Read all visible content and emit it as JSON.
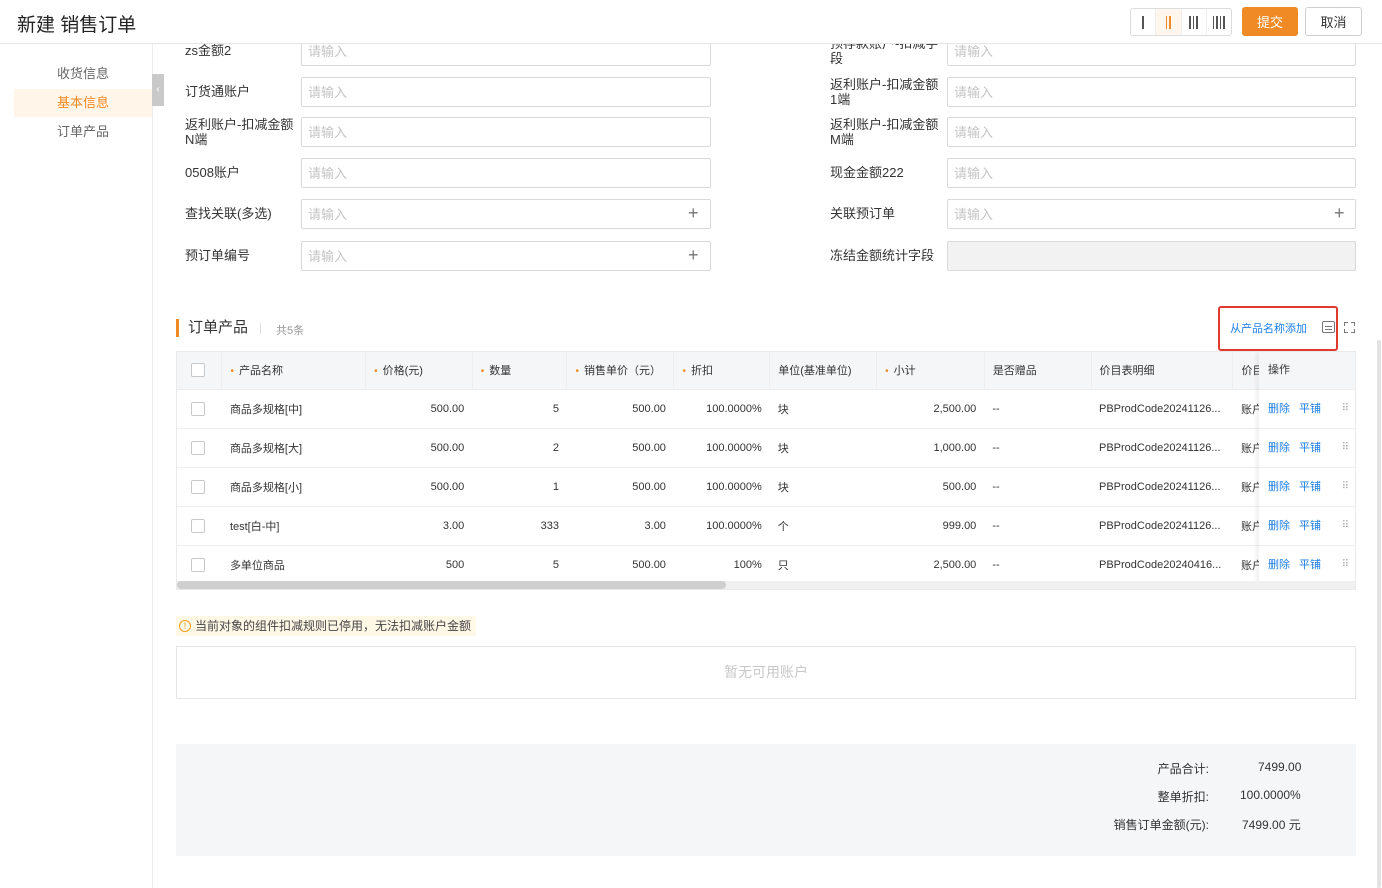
{
  "header": {
    "title": "新建 销售订单",
    "submit_label": "提交",
    "cancel_label": "取消",
    "layout_options": [
      "one-column",
      "two-column",
      "three-column",
      "four-column"
    ],
    "active_layout": "two-column",
    "accent_color": "#f08a24"
  },
  "sidebar": {
    "items": [
      {
        "label": "收货信息",
        "active": false
      },
      {
        "label": "基本信息",
        "active": true
      },
      {
        "label": "订单产品",
        "active": false
      }
    ],
    "collapse_glyph": "‹"
  },
  "form": {
    "placeholder": "请输入",
    "left": [
      {
        "label": "zs金额2"
      },
      {
        "label": "订货通账户"
      },
      {
        "label": "返利账户-扣减金额N端"
      },
      {
        "label": "0508账户"
      },
      {
        "label": "查找关联(多选)",
        "lookup": true
      },
      {
        "label": "预订单编号",
        "lookup": true
      }
    ],
    "right": [
      {
        "label": "预存款账户-扣减字段"
      },
      {
        "label": "返利账户-扣减金额1端"
      },
      {
        "label": "返利账户-扣减金额M端"
      },
      {
        "label": "现金金额222"
      },
      {
        "label": "关联预订单",
        "lookup": true
      },
      {
        "label": "冻结金额统计字段",
        "disabled": true
      }
    ]
  },
  "products": {
    "title": "订单产品",
    "count_label": "共5条",
    "add_link": "从产品名称添加",
    "columns": {
      "name": "产品名称",
      "price": "价格(元)",
      "qty": "数量",
      "unit_price": "销售单价（元）",
      "discount": "折扣",
      "unit": "单位(基准单位)",
      "subtotal": "小计",
      "gift": "是否赠品",
      "pricebook": "价目表明细",
      "pricebook_short": "价目",
      "ops": "操作"
    },
    "rows": [
      {
        "name": "商品多规格[中]",
        "price": "500.00",
        "qty": "5",
        "unit_price": "500.00",
        "discount": "100.0000%",
        "unit": "块",
        "subtotal": "2,500.00",
        "gift": "--",
        "pricebook": "PBProdCode20241126...",
        "pb_short": "账户"
      },
      {
        "name": "商品多规格[大]",
        "price": "500.00",
        "qty": "2",
        "unit_price": "500.00",
        "discount": "100.0000%",
        "unit": "块",
        "subtotal": "1,000.00",
        "gift": "--",
        "pricebook": "PBProdCode20241126...",
        "pb_short": "账户"
      },
      {
        "name": "商品多规格[小]",
        "price": "500.00",
        "qty": "1",
        "unit_price": "500.00",
        "discount": "100.0000%",
        "unit": "块",
        "subtotal": "500.00",
        "gift": "--",
        "pricebook": "PBProdCode20241126...",
        "pb_short": "账户"
      },
      {
        "name": "test[白-中]",
        "price": "3.00",
        "qty": "333",
        "unit_price": "3.00",
        "discount": "100.0000%",
        "unit": "个",
        "subtotal": "999.00",
        "gift": "--",
        "pricebook": "PBProdCode20241126...",
        "pb_short": "账户"
      },
      {
        "name": "多单位商品",
        "price": "500",
        "qty": "5",
        "unit_price": "500.00",
        "discount": "100%",
        "unit": "只",
        "subtotal": "2,500.00",
        "gift": "--",
        "pricebook": "PBProdCode20240416...",
        "pb_short": "账户"
      }
    ],
    "op_delete": "删除",
    "op_tile": "平铺",
    "drag_glyph": "⠿"
  },
  "notice": {
    "text": "当前对象的组件扣减规则已停用，无法扣减账户金额",
    "icon_glyph": "!"
  },
  "accounts": {
    "empty_text": "暂无可用账户"
  },
  "summary": {
    "items": [
      {
        "label": "产品合计:",
        "value": "7499.00"
      },
      {
        "label": "整单折扣:",
        "value": "100.0000%"
      },
      {
        "label": "销售订单金额(元):",
        "value": "7499.00 元"
      }
    ]
  }
}
